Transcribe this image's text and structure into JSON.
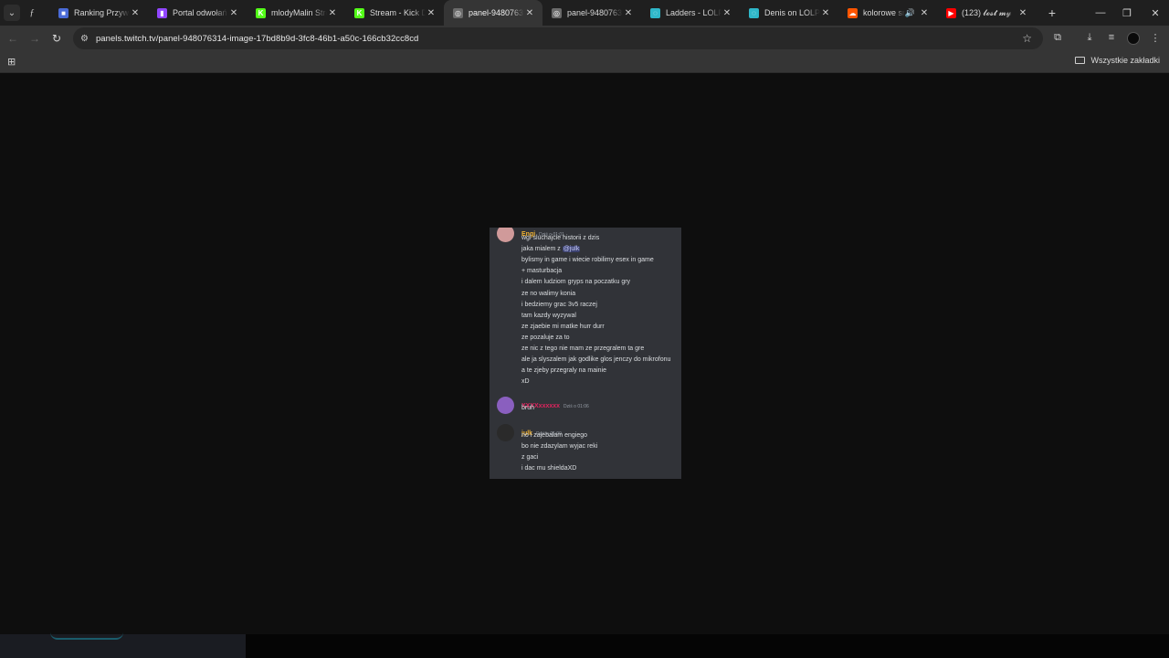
{
  "tabs": [
    {
      "title": "Ranking Przywołań",
      "favicon_color": "#4a6bd8",
      "favicon_glyph": "■"
    },
    {
      "title": "Portal odwołań - Ba",
      "favicon_color": "#9146ff",
      "favicon_glyph": "▮"
    },
    {
      "title": "mlodyMalin Stream",
      "favicon_color": "#53fc18",
      "favicon_glyph": "K"
    },
    {
      "title": "Stream - Kick Dash",
      "favicon_color": "#53fc18",
      "favicon_glyph": "K"
    },
    {
      "title": "panel-948076314-i",
      "favicon_color": "#6b6b6b",
      "favicon_glyph": "◎",
      "active": true
    },
    {
      "title": "panel-948076314-",
      "favicon_color": "#6b6b6b",
      "favicon_glyph": "◎"
    },
    {
      "title": "Ladders - LOLPros",
      "favicon_color": "#2fb7c9",
      "favicon_glyph": "◌"
    },
    {
      "title": "Denis on LOLPros",
      "favicon_color": "#2fb7c9",
      "favicon_glyph": "◌"
    },
    {
      "title": "kolorowe sny",
      "favicon_color": "#ff5500",
      "favicon_glyph": "☁",
      "audio": true
    },
    {
      "title": "(123) 𝓵𝓸𝓼𝓽 𝓶𝔂",
      "favicon_color": "#ff0000",
      "favicon_glyph": "▶"
    }
  ],
  "address_bar": {
    "url": "panels.twitch.tv/panel-948076314-image-17bd8b9d-3fc8-46b1-a50c-166cb32cc8cd"
  },
  "bookmarks": {
    "all_bookmarks_label": "Wszystkie zakładki"
  },
  "icons": {
    "tab_search": "chevron-down-icon",
    "tab_close": "close-icon",
    "new_tab": "plus-icon",
    "back": "arrow-left-icon",
    "forward": "arrow-right-icon",
    "reload": "reload-icon",
    "site_info": "tune-icon",
    "bookmark": "star-icon",
    "extensions": "puzzle-icon",
    "downloads": "download-icon",
    "media": "media-control-icon",
    "menu": "kebab-menu-icon",
    "apps": "apps-grid-icon",
    "folder": "folder-icon"
  },
  "chat": {
    "messages": [
      {
        "username": "Engi",
        "username_color": "#f0b232",
        "time": "Dziś o 01:01",
        "avatar_color": "#d09a9a",
        "lines": [
          "wgl sluchajcie historii z dzis",
          "jaka mialem z ",
          "bylismy in game i wiecie robilimy esex in game",
          "+ masturbacja",
          "i dalem ludziom gryps na poczatku gry",
          "ze no walimy konia",
          "i bedziemy grac 3v5 raczej",
          "tam kazdy wyzywal",
          "ze zjaebie mi matke hurr durr",
          "ze pozaluje za to",
          "ze nic z tego nie mam ze przegralem ta gre",
          "ale ja slyszalem jak godlike glos jenczy do mikrofonu",
          "a te zjeby przegraly na mainie",
          "xD"
        ],
        "mention": "@julk"
      },
      {
        "username": "XXXXxxxxxx",
        "username_color": "#e0245e",
        "time": "Dziś o 01:06",
        "avatar_color": "#8a5fbf",
        "lines": [
          "bruh"
        ]
      },
      {
        "username": "julk",
        "username_color": "#f0b232",
        "time": "Dziś o 01:09",
        "avatar_color": "#2a2a2a",
        "lines": [
          "no i zajebalam engiego",
          "bo nie zdazylam wyjac reki",
          "z gaci",
          "i dac mu shieldaXD"
        ]
      }
    ]
  }
}
